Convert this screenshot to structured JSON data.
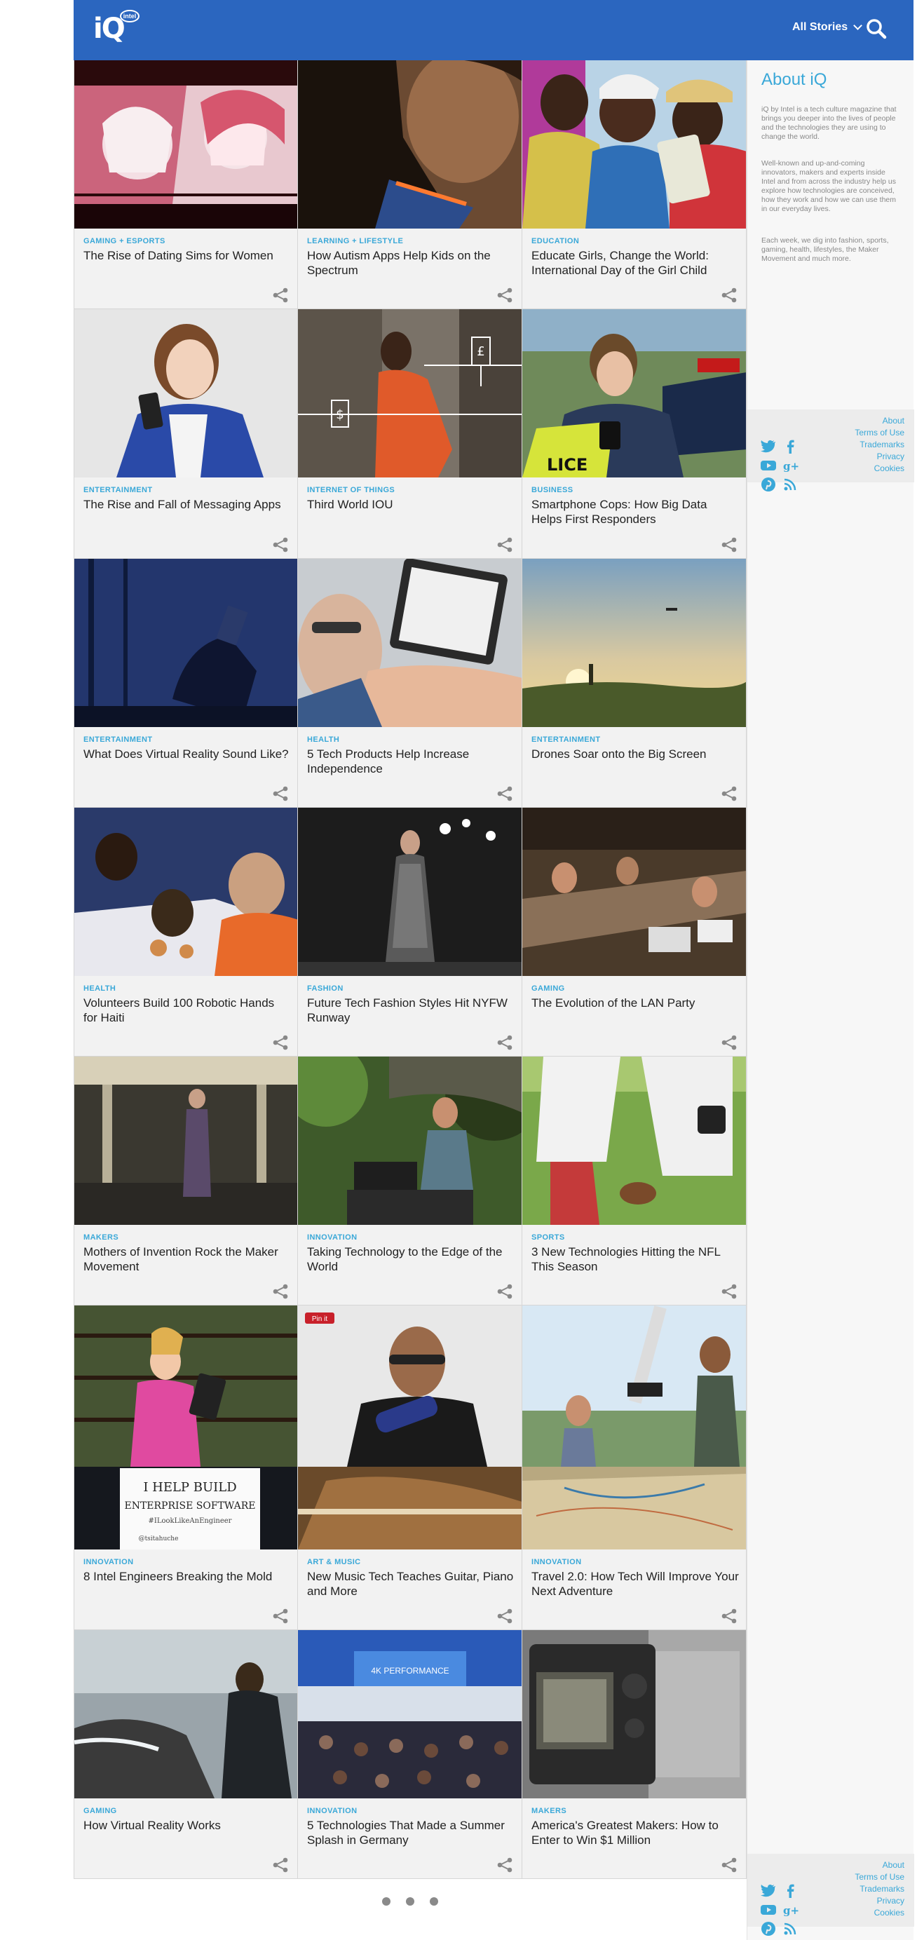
{
  "header": {
    "logo_text": "iQ",
    "logo_badge": "intel",
    "nav_label": "All Stories",
    "colors": {
      "bar": "#2b66bf",
      "accent": "#3aa8d8"
    }
  },
  "cards": [
    {
      "category": "GAMING + ESPORTS",
      "title": "The Rise of Dating Sims for Women"
    },
    {
      "category": "LEARNING + LIFESTYLE",
      "title": "How Autism Apps Help Kids on the Spectrum"
    },
    {
      "category": "EDUCATION",
      "title": "Educate Girls, Change the World: International Day of the Girl Child"
    },
    {
      "category": "ENTERTAINMENT",
      "title": "The Rise and Fall of Messaging Apps"
    },
    {
      "category": "INTERNET OF THINGS",
      "title": "Third World IOU"
    },
    {
      "category": "BUSINESS",
      "title": "Smartphone Cops: How Big Data Helps First Responders"
    },
    {
      "category": "ENTERTAINMENT",
      "title": "What Does Virtual Reality Sound Like?"
    },
    {
      "category": "HEALTH",
      "title": "5 Tech Products Help Increase Independence"
    },
    {
      "category": "ENTERTAINMENT",
      "title": "Drones Soar onto the Big Screen"
    },
    {
      "category": "HEALTH",
      "title": "Volunteers Build 100 Robotic Hands for Haiti"
    },
    {
      "category": "FASHION",
      "title": "Future Tech Fashion Styles Hit NYFW Runway"
    },
    {
      "category": "GAMING",
      "title": "The Evolution of the LAN Party"
    },
    {
      "category": "MAKERS",
      "title": "Mothers of Invention Rock the Maker Movement"
    },
    {
      "category": "INNOVATION",
      "title": "Taking Technology to the Edge of the World"
    },
    {
      "category": "SPORTS",
      "title": "3 New Technologies Hitting the NFL This Season"
    },
    {
      "category": "INNOVATION",
      "title": "8 Intel Engineers Breaking the Mold"
    },
    {
      "category": "ART & MUSIC",
      "title": "New Music Tech Teaches Guitar, Piano and More"
    },
    {
      "category": "INNOVATION",
      "title": "Travel 2.0: How Tech Will Improve Your Next Adventure"
    },
    {
      "category": "GAMING",
      "title": "How Virtual Reality Works"
    },
    {
      "category": "INNOVATION",
      "title": "5 Technologies That Made a Summer Splash in Germany"
    },
    {
      "category": "MAKERS",
      "title": "America's Greatest Makers: How to Enter to Win $1 Million"
    }
  ],
  "image_text": {
    "sign_line1": "I HELP BUILD",
    "sign_line2": "ENTERPRISE SOFTWARE",
    "sign_line3": "#ILookLikeAnEngineer",
    "sign_line4": "@tsitahuche",
    "pinit": "Pin it",
    "stage": "4K PERFORMANCE"
  },
  "sidebar": {
    "about_title": "About iQ",
    "p1": "iQ by Intel is a tech culture magazine that brings you deeper into the lives of people and the technologies they are using to change the world.",
    "p2": "Well-known and up-and-coming innovators, makers and experts inside Intel and from across the industry help us explore how technologies are conceived, how they work and how we can use them in our everyday lives.",
    "p3": "Each week, we dig into fashion, sports, gaming, health, lifestyles, the Maker Movement and much more.",
    "footer_links": [
      "About",
      "Terms of Use",
      "Trademarks",
      "Privacy",
      "Cookies"
    ],
    "social_icons": [
      "twitter-icon",
      "facebook-icon",
      "youtube-icon",
      "google-plus-icon",
      "pinterest-icon",
      "rss-icon"
    ]
  },
  "pagination": {
    "dots": 3
  }
}
